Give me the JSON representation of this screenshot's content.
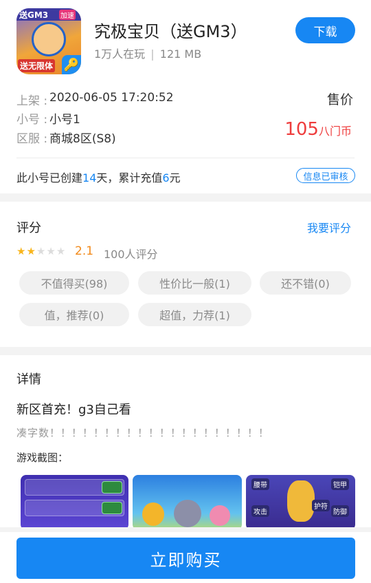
{
  "app": {
    "title": "究极宝贝（送GM3）",
    "players": "1万人在玩",
    "separator": "|",
    "size": "121 MB",
    "download_label": "下载",
    "icon_text_top": "送GM3",
    "icon_text_corner": "加速",
    "icon_text_bottom": "送无限体"
  },
  "listing": {
    "listed_label": "上架 :",
    "listed_value": "2020-06-05 17:20:52",
    "account_label": "小号 :",
    "account_value": "小号1",
    "server_label": "区服 :",
    "server_value": "商城8区(S8)",
    "price_label": "售价",
    "price_value": "105",
    "price_unit": "八门币",
    "info_prefix": "此小号已创建",
    "info_days": "14",
    "info_mid": "天，累计充值",
    "info_amount": "6",
    "info_suffix": "元",
    "verified_badge": "信息已审核",
    "price_color": "#ee3c3c",
    "accent_color": "#1787f3"
  },
  "rating": {
    "title": "评分",
    "rate_link": "我要评分",
    "stars_filled": 2,
    "stars_total": 5,
    "score": "2.1",
    "count": "100人评分",
    "tags": [
      "不值得买(98)",
      "性价比一般(1)",
      "还不错(0)",
      "值，推荐(0)",
      "超值，力荐(1)"
    ]
  },
  "detail": {
    "title": "详情",
    "line1": "新区首充！g3自己看",
    "line2": "凑字数！！！！！！！！！！！！！！！！！！！！",
    "screenshot_label": "游戏截图：",
    "shot3_labels": [
      "腰带",
      "铠甲",
      "攻击",
      "护符",
      "防御"
    ]
  },
  "bottom": {
    "buy_label": "立即购买"
  }
}
